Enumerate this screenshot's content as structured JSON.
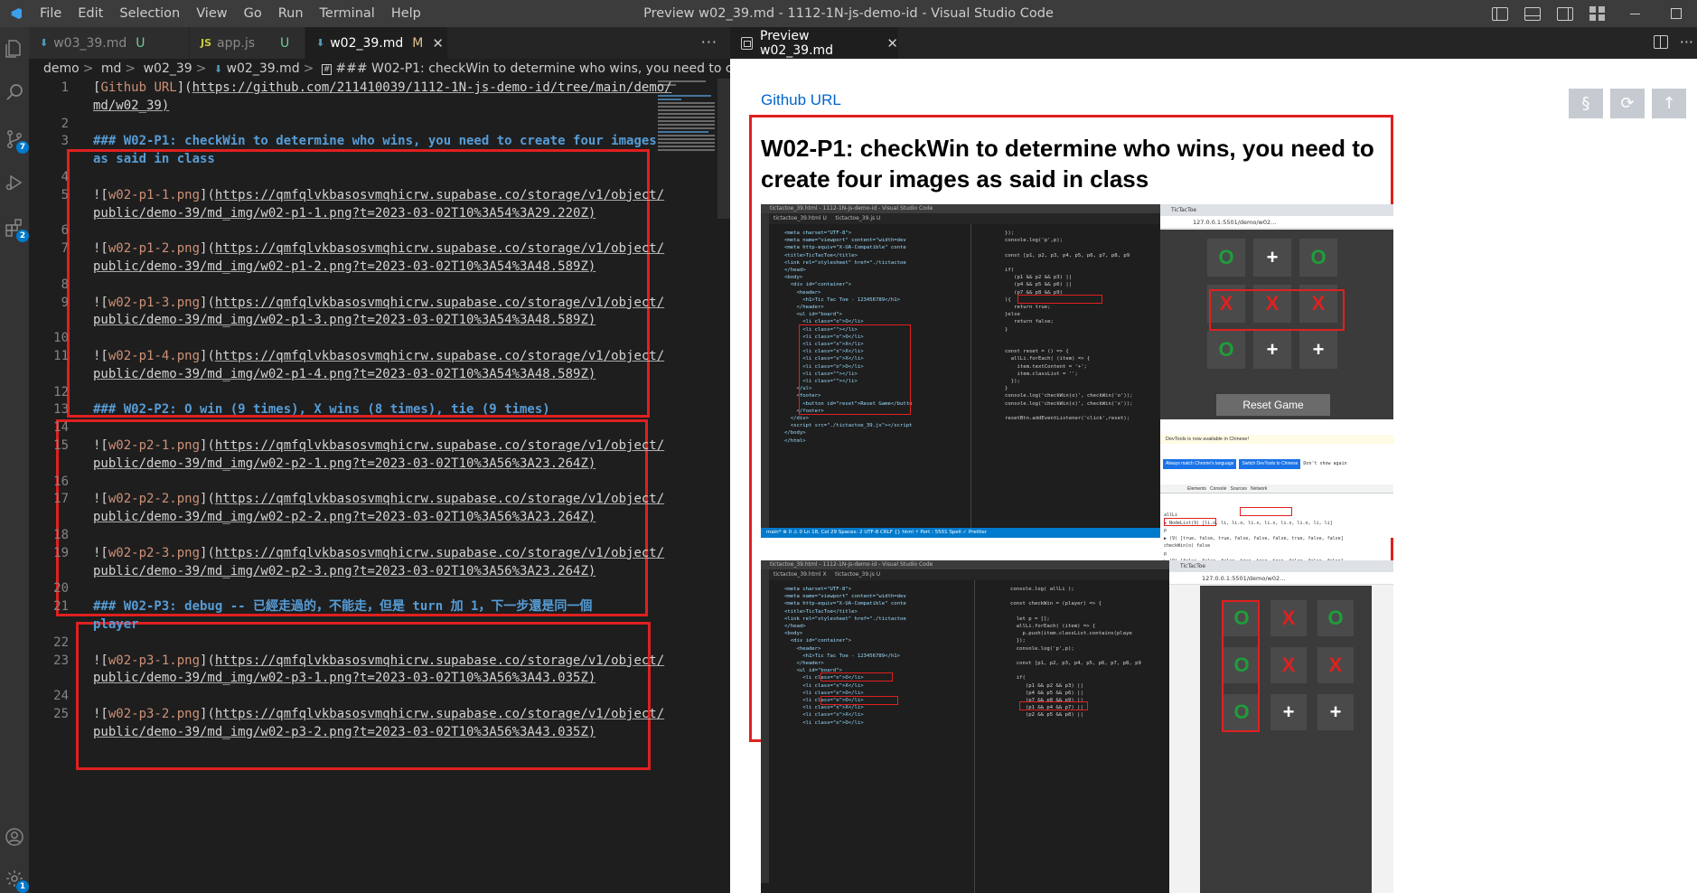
{
  "titlebar": {
    "menu": [
      "File",
      "Edit",
      "Selection",
      "View",
      "Go",
      "Run",
      "Terminal",
      "Help"
    ],
    "title": "Preview w02_39.md - 1112-1N-js-demo-id - Visual Studio Code"
  },
  "activity": {
    "source_control_badge": "7",
    "extensions_badge": "2",
    "settings_badge": "1"
  },
  "tabs": [
    {
      "label": "w03_39.md",
      "status": "U",
      "icon": "markdown-icon"
    },
    {
      "label": "app.js",
      "status": "U",
      "icon": "JS"
    },
    {
      "label": "w02_39.md",
      "status": "M",
      "icon": "markdown-icon",
      "active": true
    }
  ],
  "breadcrumb": {
    "parts": [
      "demo",
      "md",
      "w02_39",
      "w02_39.md"
    ],
    "heading": "### W02-P1: checkWin to determine who wins, you need to create four images a"
  },
  "code_lines": [
    {
      "n": "1",
      "type": "link",
      "label": "Github URL",
      "url": "https://github.com/211410039/1112-1N-js-demo-id/tree/main/demo/"
    },
    {
      "n": "",
      "type": "cont",
      "text": "md/w02_39)"
    },
    {
      "n": "2",
      "type": "blank"
    },
    {
      "n": "3",
      "type": "h3",
      "text": "### W02-P1: checkWin to determine who wins, you need to create four images"
    },
    {
      "n": "",
      "type": "h3",
      "text": "as said in class"
    },
    {
      "n": "4",
      "type": "blank"
    },
    {
      "n": "5",
      "type": "img",
      "label": "w02-p1-1.png",
      "url": "https://qmfqlvkbasosvmqhicrw.supabase.co/storage/v1/object/"
    },
    {
      "n": "",
      "type": "cont",
      "text": "public/demo-39/md_img/w02-p1-1.png?t=2023-03-02T10%3A54%3A29.220Z)"
    },
    {
      "n": "6",
      "type": "blank"
    },
    {
      "n": "7",
      "type": "img",
      "label": "w02-p1-2.png",
      "url": "https://qmfqlvkbasosvmqhicrw.supabase.co/storage/v1/object/"
    },
    {
      "n": "",
      "type": "cont",
      "text": "public/demo-39/md_img/w02-p1-2.png?t=2023-03-02T10%3A54%3A48.589Z)"
    },
    {
      "n": "8",
      "type": "blank"
    },
    {
      "n": "9",
      "type": "img",
      "label": "w02-p1-3.png",
      "url": "https://qmfqlvkbasosvmqhicrw.supabase.co/storage/v1/object/"
    },
    {
      "n": "",
      "type": "cont",
      "text": "public/demo-39/md_img/w02-p1-3.png?t=2023-03-02T10%3A54%3A48.589Z)"
    },
    {
      "n": "10",
      "type": "blank"
    },
    {
      "n": "11",
      "type": "img",
      "label": "w02-p1-4.png",
      "url": "https://qmfqlvkbasosvmqhicrw.supabase.co/storage/v1/object/"
    },
    {
      "n": "",
      "type": "cont",
      "text": "public/demo-39/md_img/w02-p1-4.png?t=2023-03-02T10%3A54%3A48.589Z)"
    },
    {
      "n": "12",
      "type": "blank"
    },
    {
      "n": "13",
      "type": "h3",
      "text": "### W02-P2: O win (9 times), X wins (8 times), tie (9 times)"
    },
    {
      "n": "14",
      "type": "blank"
    },
    {
      "n": "15",
      "type": "img",
      "label": "w02-p2-1.png",
      "url": "https://qmfqlvkbasosvmqhicrw.supabase.co/storage/v1/object/"
    },
    {
      "n": "",
      "type": "cont",
      "text": "public/demo-39/md_img/w02-p2-1.png?t=2023-03-02T10%3A56%3A23.264Z)"
    },
    {
      "n": "16",
      "type": "blank"
    },
    {
      "n": "17",
      "type": "img",
      "label": "w02-p2-2.png",
      "url": "https://qmfqlvkbasosvmqhicrw.supabase.co/storage/v1/object/"
    },
    {
      "n": "",
      "type": "cont",
      "text": "public/demo-39/md_img/w02-p2-2.png?t=2023-03-02T10%3A56%3A23.264Z)"
    },
    {
      "n": "18",
      "type": "blank"
    },
    {
      "n": "19",
      "type": "img",
      "label": "w02-p2-3.png",
      "url": "https://qmfqlvkbasosvmqhicrw.supabase.co/storage/v1/object/"
    },
    {
      "n": "",
      "type": "cont",
      "text": "public/demo-39/md_img/w02-p2-3.png?t=2023-03-02T10%3A56%3A23.264Z)"
    },
    {
      "n": "20",
      "type": "blank"
    },
    {
      "n": "21",
      "type": "h3",
      "text": "### W02-P3: debug -- 已經走過的，不能走，但是 turn 加 1，下一步還是同一個"
    },
    {
      "n": "",
      "type": "h3",
      "text": "player"
    },
    {
      "n": "22",
      "type": "blank"
    },
    {
      "n": "23",
      "type": "img",
      "label": "w02-p3-1.png",
      "url": "https://qmfqlvkbasosvmqhicrw.supabase.co/storage/v1/object/"
    },
    {
      "n": "",
      "type": "cont",
      "text": "public/demo-39/md_img/w02-p3-1.png?t=2023-03-02T10%3A56%3A43.035Z)"
    },
    {
      "n": "24",
      "type": "blank"
    },
    {
      "n": "25",
      "type": "img",
      "label": "w02-p3-2.png",
      "url": "https://qmfqlvkbasosvmqhicrw.supabase.co/storage/v1/object/"
    },
    {
      "n": "",
      "type": "cont",
      "text": "public/demo-39/md_img/w02-p3-2.png?t=2023-03-02T10%3A56%3A43.035Z)"
    }
  ],
  "preview": {
    "tab_label": "Preview w02_39.md",
    "github_link": "Github URL",
    "heading": "W02-P1: checkWin to determine who wins, you need to create four images as said in class",
    "buttons": [
      "§",
      "⟳",
      "↑"
    ]
  },
  "shot1": {
    "vs_title": "tictactoe_39.html - 1112-1N-js-demo-id - Visual Studio Code",
    "tab_html": "tictactoe_39.html U",
    "tab_js": "tictactoe_39.js U",
    "html_code": "<meta charset=\"UTF-8\">\n<meta name=\"viewport\" content=\"width=dev\n<meta http-equiv=\"X-UA-Compatible\" conte\n<title>TicTacToe</title>\n<link rel=\"stylesheet\" href=\"./tictactoe\n</head>\n<body>\n  <div id=\"container\">\n    <header>\n      <h1>Tic Tac Toe - 123456789</h1>\n    </header>\n    <ul id=\"board\">\n      <li class=\"o\">O</li>\n      <li class=\"\"></li>\n      <li class=\"o\">O</li>\n      <li class=\"x\">X</li>\n      <li class=\"x\">X</li>\n      <li class=\"x\">X</li>\n      <li class=\"o\">O</li>\n      <li class=\"\"></li>\n      <li class=\"\"></li>\n    </ul>\n    <footer>\n      <button id=\"reset\">Reset Game</butto\n    </footer>\n  </div>\n  <script src=\"./tictactoe_39.js\"></script\n</body>\n</html>",
    "js_code": "});\nconsole.log('p',p);\n\nconst [p1, p2, p3, p4, p5, p6, p7, p8, p9\n\nif(\n   (p1 && p2 && p3) ||\n   (p4 && p5 && p6) ||\n   (p7 && p8 && p9)\n){\n   return true;\n}else\n   return false;\n}\n\n\nconst reset = () => {\n  allLi.forEach( (item) => {\n    item.textContent = '+';\n    item.classList = '';\n  });\n}\nconsole.log('checkWin(o)', checkWin('o'));\nconsole.log('checkWin(x)', checkWin('x'));\n\nresetBtn.addEventListener('click',reset);",
    "status": "main*   ⊗ 0 ⚠ 0        Ln 18, Col 29  Spaces: 2  UTF-8  CRLF  {} html  ⚡ Port : 5501  Spell  ✓ Prettier",
    "browser_tab": "TicTacToe",
    "url": "127.0.0.1:5501/demo/w02...",
    "board": [
      "O",
      "+",
      "O",
      "X",
      "X",
      "X",
      "O",
      "+",
      "+"
    ],
    "reset": "Reset Game",
    "devtools_banner": "DevTools is now available in Chinese!",
    "devtools_btn1": "Always match Chrome's language",
    "devtools_btn2": "Switch DevTools to Chinese",
    "devtools_btn3": "Don't show again",
    "devtools_tabs": "Elements   Console   Sources   Network",
    "console": "allLi\n▶ NodeList(9) [li.o, li, li.o, li.x, li.x, li.x, li.o, li, li]\np\n▶ (9) [true, false, true, false, false, false, true, false, false]\ncheckWin(o) false\np\n▶ (9) [false, false, false, true, true, true, false, false, false]\ncheckWin(x) true"
  },
  "shot2": {
    "vs_title": "tictactoe_39.html - 1112-1N-js-demo-id - Visual Studio Code",
    "tab_html": "tictactoe_39.html X",
    "tab_js": "tictactoe_39.js U",
    "html_code": "<meta charset=\"UTF-8\">\n<meta name=\"viewport\" content=\"width=dev\n<meta http-equiv=\"X-UA-Compatible\" conte\n<title>TicTacToe</title>\n<link rel=\"stylesheet\" href=\"./tictactoe\n</head>\n<body>\n  <div id=\"container\">\n    <header>\n      <h1>Tic Tac Toe - 123456789</h1>\n    </header>\n    <ul id=\"board\">\n      <li class=\"o\">O</li>\n      <li class=\"x\">X</li>\n      <li class=\"o\">O</li>\n      <li class=\"o\">O</li>\n      <li class=\"x\">X</li>\n      <li class=\"x\">X</li>\n      <li class=\"o\">O</li>",
    "js_code": "console.log( allLi );\n\nconst checkWin = (player) => {\n\n  let p = [];\n  allLi.forEach( (item) => {\n    p.push(item.classList.contains(playe\n  });\n  console.log('p',p);\n\n  const [p1, p2, p3, p4, p5, p6, p7, p8, p9\n\n  if(\n     (p1 && p2 && p3) ||\n     (p4 && p5 && p6) ||\n     (p7 && p8 && p9) ||\n     (p1 && p4 && p7) ||\n     (p2 && p5 && p8) ||",
    "browser_tab": "TicTacToe",
    "url": "127.0.0.1:5501/demo/w02...",
    "board": [
      "O",
      "X",
      "O",
      "O",
      "X",
      "X",
      "O",
      "+",
      "+"
    ]
  }
}
